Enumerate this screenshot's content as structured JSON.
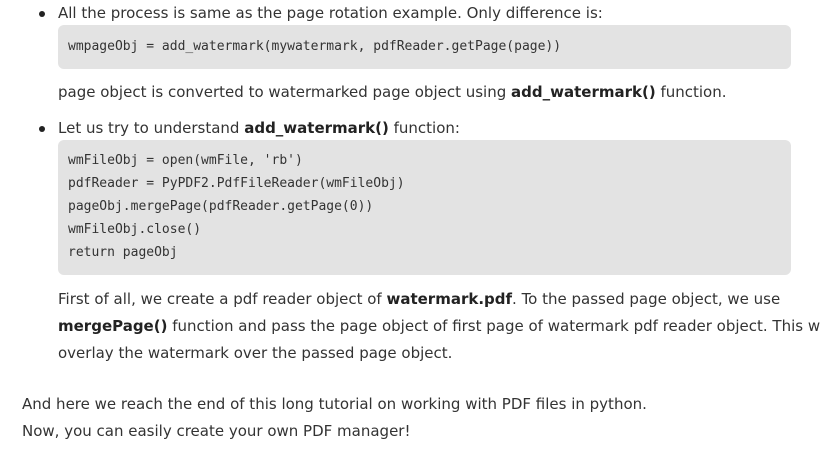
{
  "bullet1": {
    "intro": "All the process is same as the page rotation example. Only difference is:",
    "code": "wmpageObj = add_watermark(mywatermark, pdfReader.getPage(page))",
    "note_pre": "page object is converted to watermarked page object using ",
    "note_bold": "add_watermark()",
    "note_post": " function."
  },
  "bullet2": {
    "intro_pre": "Let us try to understand ",
    "intro_bold": "add_watermark()",
    "intro_post": " function:",
    "code_lines": [
      "wmFileObj = open(wmFile, 'rb')",
      "pdfReader = PyPDF2.PdfFileReader(wmFileObj)",
      "pageObj.mergePage(pdfReader.getPage(0))",
      "wmFileObj.close()",
      "return pageObj"
    ],
    "para_l1_pre": "First of all, we create a pdf reader object of ",
    "para_l1_bold": "watermark.pdf",
    "para_l1_post": ". To the passed page object, we use",
    "para_l2_bold": "mergePage()",
    "para_l2_post": " function and pass the page object of first page of watermark pdf reader object. This will",
    "para_l3": "overlay the watermark over the passed page object."
  },
  "closing": {
    "line1": "And here we reach the end of this long tutorial on working with PDF files in python.",
    "line2": "Now, you can easily create your own PDF manager!"
  }
}
